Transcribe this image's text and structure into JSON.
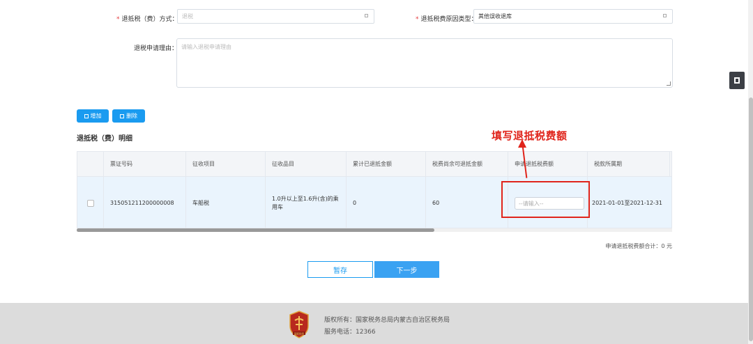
{
  "form": {
    "refund_method": {
      "label": "退抵税（费）方式：",
      "required_mark": "*",
      "value": "退税"
    },
    "reason_type": {
      "label": "退抵税费原因类型：",
      "required_mark": "*",
      "value": "其他误收退库"
    },
    "reason": {
      "label": "退税申请理由：",
      "placeholder": "请输入退税申请理由"
    }
  },
  "actions": {
    "add_label": "增加",
    "delete_label": "删除"
  },
  "section_title": "退抵税（费）明细",
  "annotation": "填写退抵税费额",
  "table": {
    "headers": [
      "票证号码",
      "征收项目",
      "征收品目",
      "累计已退抵金额",
      "税费尚余可退抵金额",
      "申请退抵税费额",
      "税款所属期"
    ],
    "row": {
      "ticket_no": "315051211200000008",
      "item": "车船税",
      "sub_item": "1.0升以上至1.6升(含)的乘用车",
      "refunded": "0",
      "remaining": "60",
      "amount_placeholder": "--请输入--",
      "period": "2021-01-01至2021-12-31"
    }
  },
  "total_label": "申请退抵税费额合计：0 元",
  "buttons": {
    "save": "暂存",
    "next": "下一步"
  },
  "footer": {
    "copyright": "版权所有：国家税务总局内蒙古自治区税务局",
    "phone": "服务电话：12366",
    "logo_text": "国家税务"
  },
  "colors": {
    "primary": "#1a9bf0",
    "annotation_red": "#e0241b",
    "row_highlight": "#eaf4fd"
  }
}
